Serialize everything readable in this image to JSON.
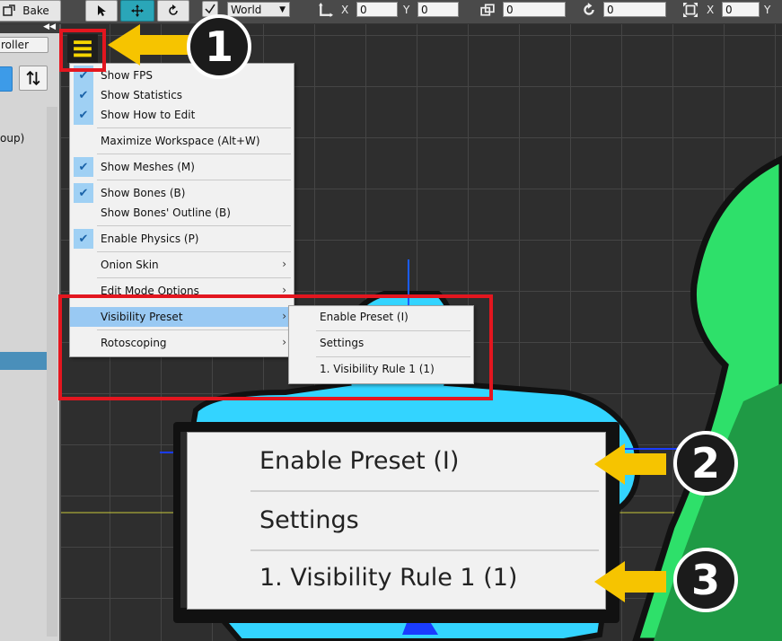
{
  "toolbar": {
    "bake_label": "Bake",
    "space_select": "World",
    "x_label": "X",
    "y_label": "Y",
    "pos_x": "0",
    "pos_y": "0",
    "depth": "0",
    "rotation": "0",
    "scale_x_label": "X",
    "scale_x": "0",
    "scale_y_label": "Y"
  },
  "left_panel": {
    "tab_label": "roller",
    "list_item": "oup)",
    "collapse": "◀◀"
  },
  "menu": {
    "items": [
      {
        "label": "Show FPS",
        "checked": true
      },
      {
        "label": "Show Statistics",
        "checked": true
      },
      {
        "label": "Show How to Edit",
        "checked": true
      },
      {
        "label": "Maximize Workspace (Alt+W)",
        "checked": false
      },
      {
        "label": "Show Meshes (M)",
        "checked": true
      },
      {
        "label": "Show Bones (B)",
        "checked": true
      },
      {
        "label": "Show Bones' Outline (B)",
        "checked": false
      },
      {
        "label": "Enable Physics (P)",
        "checked": true
      },
      {
        "label": "Onion Skin",
        "submenu": true
      },
      {
        "label": "Edit Mode Options",
        "submenu": true
      },
      {
        "label": "Visibility Preset",
        "submenu": true,
        "highlighted": true
      },
      {
        "label": "Rotoscoping",
        "submenu": true
      }
    ],
    "arrow": "›",
    "check": "✔"
  },
  "submenu": {
    "items": [
      "Enable Preset (I)",
      "Settings",
      "1. Visibility Rule 1 (1)"
    ]
  },
  "zoom": {
    "items": [
      "Enable Preset (I)",
      "Settings",
      "1. Visibility Rule 1 (1)"
    ]
  },
  "badges": [
    "1",
    "2",
    "3"
  ],
  "colors": {
    "accent_red": "#e3161f",
    "arrow_yellow": "#f6c400",
    "character_blue": "#33d4ff",
    "character_green": "#2ee06a",
    "menu_highlight": "#99c9f3"
  }
}
